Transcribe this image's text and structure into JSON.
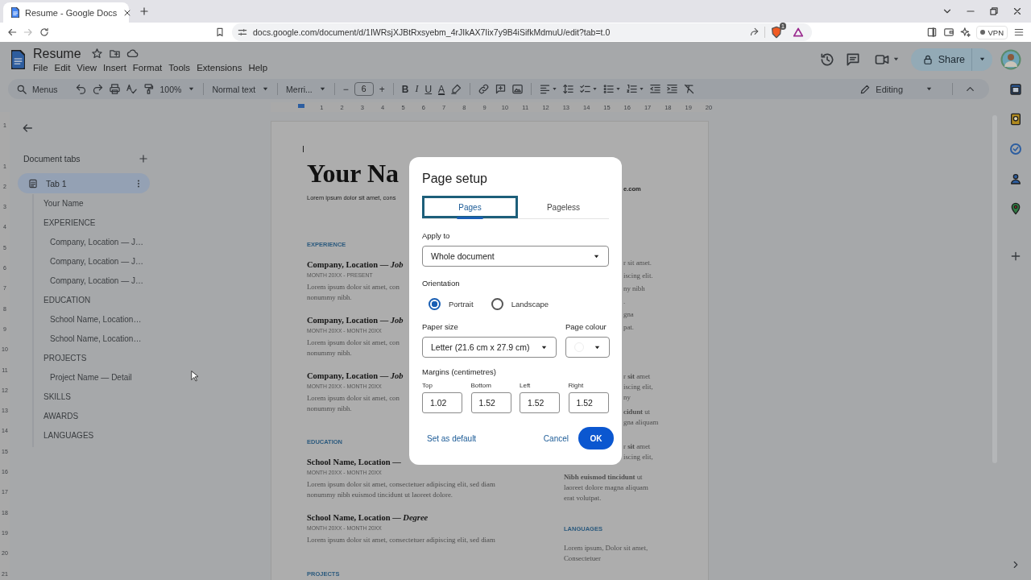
{
  "browser": {
    "tab_title": "Resume - Google Docs",
    "url": "docs.google.com/document/d/1IWRsjXJBtRxsyebm_4rJIkAX7Iix7y9B4iSifkMdmuU/edit?tab=t.0",
    "shield_badge": "1",
    "vpn": "VPN"
  },
  "docs": {
    "title": "Resume",
    "menu": [
      "File",
      "Edit",
      "View",
      "Insert",
      "Format",
      "Tools",
      "Extensions",
      "Help"
    ],
    "share": "Share"
  },
  "toolbar": {
    "search": "Menus",
    "zoom": "100%",
    "style": "Normal text",
    "font": "Merri...",
    "size_minus": "−",
    "size": "6",
    "size_plus": "+",
    "bold": "B",
    "italic": "I",
    "underline": "U",
    "text_color": "A",
    "mode": "Editing"
  },
  "ruler": {
    "horizontal": [
      "1",
      "2",
      "3",
      "4",
      "5",
      "6",
      "7",
      "8",
      "9",
      "10",
      "11",
      "12",
      "13",
      "14",
      "15",
      "16",
      "17",
      "18",
      "19",
      "20"
    ],
    "vertical": [
      "1",
      "1",
      "2",
      "3",
      "4",
      "5",
      "6",
      "7",
      "8",
      "9",
      "10",
      "11",
      "12",
      "13",
      "14",
      "15",
      "16",
      "17",
      "18",
      "19",
      "20",
      "21"
    ]
  },
  "outline": {
    "heading": "Document tabs",
    "tabs": [
      {
        "label": "Tab 1",
        "selected": true,
        "children": [
          {
            "label": "Your Name"
          },
          {
            "label": "EXPERIENCE",
            "children": [
              {
                "label": "Company, Location — J…"
              },
              {
                "label": "Company, Location — J…"
              },
              {
                "label": "Company, Location — J…"
              }
            ]
          },
          {
            "label": "EDUCATION",
            "children": [
              {
                "label": "School Name, Location…"
              },
              {
                "label": "School Name, Location…"
              }
            ]
          },
          {
            "label": "PROJECTS",
            "children": [
              {
                "label": "Project Name — Detail"
              }
            ]
          },
          {
            "label": "SKILLS"
          },
          {
            "label": "AWARDS"
          },
          {
            "label": "LANGUAGES"
          }
        ]
      }
    ]
  },
  "document": {
    "left": [
      {
        "kind": "title",
        "text": "Your Na"
      },
      {
        "kind": "contact",
        "text": "Lorem ipsum dolor sit amet, cons"
      },
      {
        "kind": "section",
        "text": "EXPERIENCE"
      },
      {
        "kind": "entry",
        "text": "Company, Location — *Job*"
      },
      {
        "kind": "date",
        "text": "MONTH 20XX - PRESENT"
      },
      {
        "kind": "body",
        "text": "Lorem ipsum dolor sit amet, con"
      },
      {
        "kind": "body",
        "text": "nonummy nibh."
      },
      {
        "kind": "entry",
        "text": "Company, Location — *Job*"
      },
      {
        "kind": "date",
        "text": "MONTH 20XX - MONTH 20XX"
      },
      {
        "kind": "body",
        "text": "Lorem ipsum dolor sit amet, con"
      },
      {
        "kind": "body",
        "text": "nonummy nibh."
      },
      {
        "kind": "entry",
        "text": "Company, Location — *Job*"
      },
      {
        "kind": "date",
        "text": "MONTH 20XX - MONTH 20XX"
      },
      {
        "kind": "body",
        "text": "Lorem ipsum dolor sit amet, con"
      },
      {
        "kind": "body",
        "text": "nonummy nibh."
      },
      {
        "kind": "section",
        "text": "EDUCATION"
      },
      {
        "kind": "entry",
        "text": "School Name, Location —"
      },
      {
        "kind": "date",
        "text": "MONTH 20XX - MONTH 20XX"
      },
      {
        "kind": "body",
        "text": "Lorem ipsum dolor sit amet, consectetuer adipiscing elit, sed diam"
      },
      {
        "kind": "body",
        "text": "nonummy nibh euismod tincidunt ut laoreet dolore."
      },
      {
        "kind": "entry",
        "text": "School Name, Location — *Degree*"
      },
      {
        "kind": "date",
        "text": "MONTH 20XX - MONTH 20XX"
      },
      {
        "kind": "body",
        "text": "Lorem ipsum dolor sit amet, consectetuer adipiscing elit, sed diam"
      },
      {
        "kind": "section",
        "text": "PROJECTS"
      }
    ],
    "right": [
      {
        "kind": "contact",
        "lines": [
          "e.com"
        ]
      },
      {
        "kind": "fragment",
        "lines": [
          "r sit amet.",
          "iscing elit.",
          "ny nibh",
          ".",
          "gna",
          "pat."
        ]
      },
      {
        "kind": "fragment",
        "lines": [
          "r **sit** amet",
          "iscing elit,",
          "ny"
        ]
      },
      {
        "kind": "fragment",
        "lines": [
          "**cidunt** ut",
          "gna aliquam"
        ]
      },
      {
        "kind": "fragment",
        "lines": [
          "r **sit** amet",
          "iscing elit,"
        ]
      },
      {
        "kind": "body",
        "lines": [
          "**Nibh euismod tincidunt** ut",
          "laoreet dolore magna aliquam",
          "erat volutpat."
        ]
      },
      {
        "kind": "section",
        "lines": [
          "LANGUAGES"
        ]
      },
      {
        "kind": "body",
        "lines": [
          "Lorem ipsum, Dolor sit amet,",
          "Consectetuer"
        ]
      }
    ]
  },
  "dialog": {
    "title": "Page setup",
    "tabs": [
      {
        "label": "Pages",
        "selected": true
      },
      {
        "label": "Pageless",
        "selected": false
      }
    ],
    "apply_to": {
      "label": "Apply to",
      "value": "Whole document"
    },
    "orientation": {
      "label": "Orientation",
      "options": [
        {
          "label": "Portrait",
          "selected": true
        },
        {
          "label": "Landscape",
          "selected": false
        }
      ]
    },
    "paper_size": {
      "label": "Paper size",
      "value": "Letter (21.6 cm x 27.9 cm)"
    },
    "page_colour": {
      "label": "Page colour"
    },
    "margins": {
      "label": "Margins (centimetres)",
      "fields": [
        {
          "label": "Top",
          "value": "1.02"
        },
        {
          "label": "Bottom",
          "value": "1.52"
        },
        {
          "label": "Left",
          "value": "1.52"
        },
        {
          "label": "Right",
          "value": "1.52"
        }
      ]
    },
    "buttons": {
      "default": "Set as default",
      "cancel": "Cancel",
      "ok": "OK"
    }
  }
}
